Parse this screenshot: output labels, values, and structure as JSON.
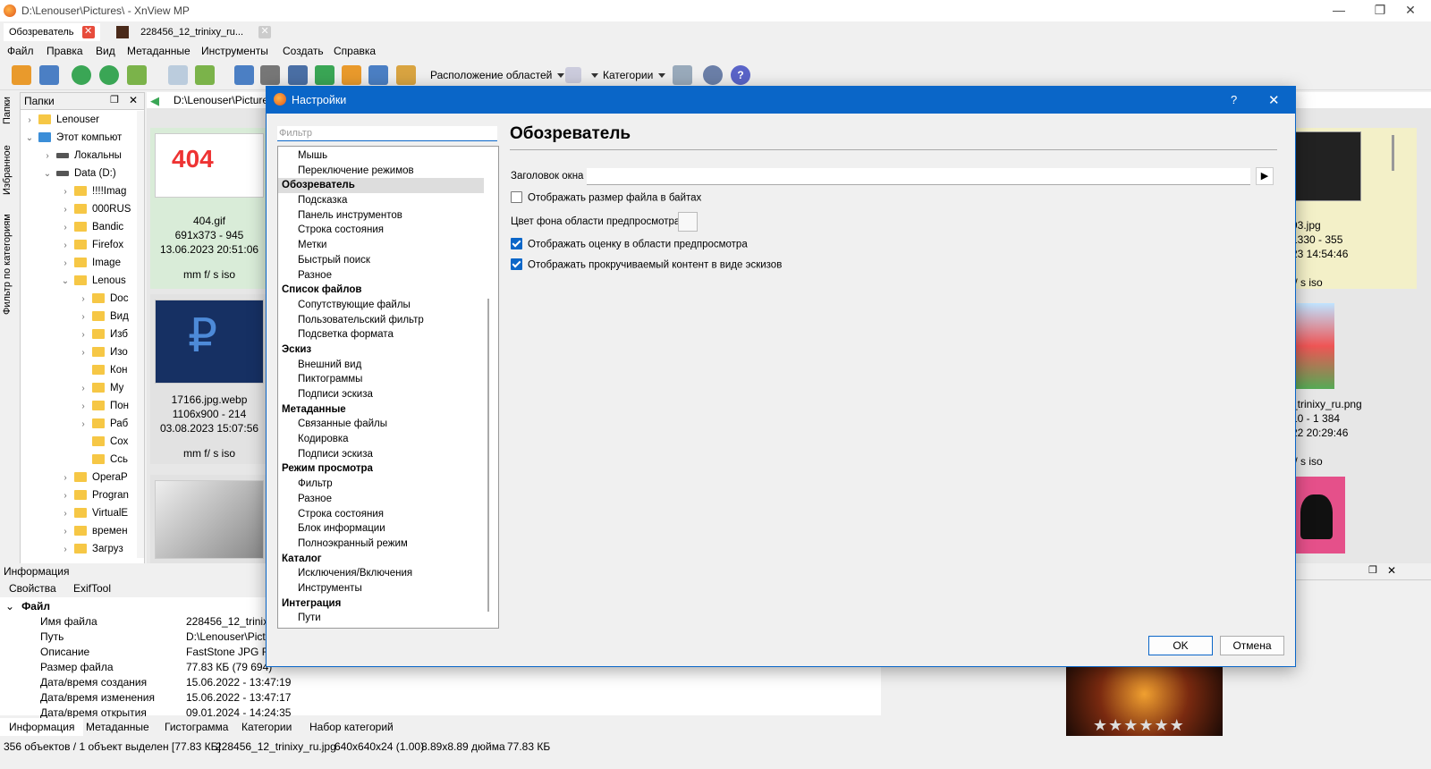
{
  "window": {
    "title": "D:\\Lenouser\\Pictures\\ - XnView MP",
    "minimize": "—",
    "maximize": "❐",
    "close": "✕"
  },
  "tabs": [
    {
      "label": "Обозреватель",
      "close": "✕"
    },
    {
      "label": "228456_12_trinixy_ru...",
      "close": "✕"
    }
  ],
  "menu": [
    "Файл",
    "Правка",
    "Вид",
    "Метаданные",
    "Инструменты",
    "Создать",
    "Справка"
  ],
  "toolbar": {
    "layout_label": "Расположение областей",
    "categories_label": "Категории"
  },
  "side_tabs": [
    "Папки",
    "Избранное",
    "Фильтр по категориям"
  ],
  "folders_panel": {
    "title": "Папки",
    "items": [
      {
        "label": "Lenouser",
        "indent": 0,
        "chev": "›"
      },
      {
        "label": "Этот компьют",
        "indent": 0,
        "chev": "⌄"
      },
      {
        "label": "Локальны",
        "indent": 1,
        "chev": "›"
      },
      {
        "label": "Data (D:)",
        "indent": 1,
        "chev": "⌄"
      },
      {
        "label": "!!!!Imag",
        "indent": 2,
        "chev": "›"
      },
      {
        "label": "000RUS",
        "indent": 2,
        "chev": "›"
      },
      {
        "label": "Bandic",
        "indent": 2,
        "chev": "›"
      },
      {
        "label": "Firefox",
        "indent": 2,
        "chev": "›"
      },
      {
        "label": "Image",
        "indent": 2,
        "chev": "›"
      },
      {
        "label": "Lenous",
        "indent": 2,
        "chev": "⌄"
      },
      {
        "label": "Doc",
        "indent": 3,
        "chev": "›"
      },
      {
        "label": "Вид",
        "indent": 3,
        "chev": "›"
      },
      {
        "label": "Изб",
        "indent": 3,
        "chev": "›"
      },
      {
        "label": "Изо",
        "indent": 3,
        "chev": "›"
      },
      {
        "label": "Кон",
        "indent": 3,
        "chev": ""
      },
      {
        "label": "My",
        "indent": 3,
        "chev": "›"
      },
      {
        "label": "Пон",
        "indent": 3,
        "chev": "›"
      },
      {
        "label": "Раб",
        "indent": 3,
        "chev": "›"
      },
      {
        "label": "Сох",
        "indent": 3,
        "chev": ""
      },
      {
        "label": "Ссь",
        "indent": 3,
        "chev": ""
      },
      {
        "label": "OperaP",
        "indent": 2,
        "chev": "›"
      },
      {
        "label": "Progran",
        "indent": 2,
        "chev": "›"
      },
      {
        "label": "VirtualE",
        "indent": 2,
        "chev": "›"
      },
      {
        "label": "времен",
        "indent": 2,
        "chev": "›"
      },
      {
        "label": "Загруз",
        "indent": 2,
        "chev": "›"
      }
    ]
  },
  "address": "D:\\Lenouser\\Pictures\\",
  "thumbnails": [
    {
      "name": "404.gif",
      "dims": "691x373 - 945",
      "date": "13.06.2023 20:51:06",
      "extra": "mm f/ s iso",
      "img_text": "404"
    },
    {
      "name": "17166.jpg.webp",
      "dims": "1106x900 - 214",
      "date": "03.08.2023 15:07:56",
      "extra": "mm f/ s iso",
      "img_text": "₽"
    },
    {
      "name": "93.jpg",
      "dims": "1330 - 355",
      "date": "23 14:54:46",
      "extra": "f/ s iso"
    },
    {
      "name": "_trinixy_ru.png",
      "dims": "10 - 1 384",
      "date": "22 20:29:46",
      "extra": "f/ s iso"
    }
  ],
  "info_panel": {
    "title": "Информация",
    "tabs": [
      "Свойства",
      "ExifTool"
    ],
    "section": "Файл",
    "rows": [
      {
        "k": "Имя файла",
        "v": "228456_12_trinixy"
      },
      {
        "k": "Путь",
        "v": "D:\\Lenouser\\Pict"
      },
      {
        "k": "Описание",
        "v": "FastStone JPG File"
      },
      {
        "k": "Размер файла",
        "v": "77.83 КБ (79 694)"
      },
      {
        "k": "Дата/время создания",
        "v": "15.06.2022 - 13:47:19"
      },
      {
        "k": "Дата/время изменения",
        "v": "15.06.2022 - 13:47:17"
      },
      {
        "k": "Дата/время открытия",
        "v": "09.01.2024 - 14:24:35"
      }
    ]
  },
  "bottom_tabs": [
    "Информация",
    "Метаданные",
    "Гистограмма",
    "Категории",
    "Набор категорий"
  ],
  "status": [
    "356 объектов / 1 объект выделен [77.83 КБ]",
    "228456_12_trinixy_ru.jpg",
    "640x640x24 (1.00)",
    "8.89x8.89 дюйма",
    "77.83 КБ"
  ],
  "preview": {
    "stars": "★★★★★★"
  },
  "dialog": {
    "title": "Настройки",
    "help": "?",
    "close": "✕",
    "filter_placeholder": "Фильтр",
    "nav": [
      {
        "label": "Мышь",
        "type": "child"
      },
      {
        "label": "Переключение режимов",
        "type": "child"
      },
      {
        "label": "Обозреватель",
        "type": "group",
        "selected": true
      },
      {
        "label": "Подсказка",
        "type": "child"
      },
      {
        "label": "Панель инструментов",
        "type": "child"
      },
      {
        "label": "Строка состояния",
        "type": "child"
      },
      {
        "label": "Метки",
        "type": "child"
      },
      {
        "label": "Быстрый поиск",
        "type": "child"
      },
      {
        "label": "Разное",
        "type": "child"
      },
      {
        "label": "Список файлов",
        "type": "group"
      },
      {
        "label": "Сопутствующие файлы",
        "type": "child"
      },
      {
        "label": "Пользовательский фильтр",
        "type": "child"
      },
      {
        "label": "Подсветка формата",
        "type": "child"
      },
      {
        "label": "Эскиз",
        "type": "group"
      },
      {
        "label": "Внешний вид",
        "type": "child"
      },
      {
        "label": "Пиктограммы",
        "type": "child"
      },
      {
        "label": "Подписи эскиза",
        "type": "child"
      },
      {
        "label": "Метаданные",
        "type": "group"
      },
      {
        "label": "Связанные файлы",
        "type": "child"
      },
      {
        "label": "Кодировка",
        "type": "child"
      },
      {
        "label": "Подписи эскиза",
        "type": "child"
      },
      {
        "label": "Режим просмотра",
        "type": "group"
      },
      {
        "label": "Фильтр",
        "type": "child"
      },
      {
        "label": "Разное",
        "type": "child"
      },
      {
        "label": "Строка состояния",
        "type": "child"
      },
      {
        "label": "Блок информации",
        "type": "child"
      },
      {
        "label": "Полноэкранный режим",
        "type": "child"
      },
      {
        "label": "Каталог",
        "type": "group"
      },
      {
        "label": "Исключения/Включения",
        "type": "child"
      },
      {
        "label": "Инструменты",
        "type": "child"
      },
      {
        "label": "Интеграция",
        "type": "group"
      },
      {
        "label": "Пути",
        "type": "child"
      }
    ],
    "section_title": "Обозреватель",
    "window_title_label": "Заголовок окна",
    "window_title_value": "",
    "options": [
      {
        "label": "Отображать размер файла в байтах",
        "checked": false
      },
      {
        "label": "Отображать оценку в области предпросмотра",
        "checked": true
      },
      {
        "label": "Отображать прокручиваемый контент в виде эскизов",
        "checked": true
      }
    ],
    "bg_color_label": "Цвет фона области предпросмотра",
    "ok": "OK",
    "cancel": "Отмена"
  }
}
